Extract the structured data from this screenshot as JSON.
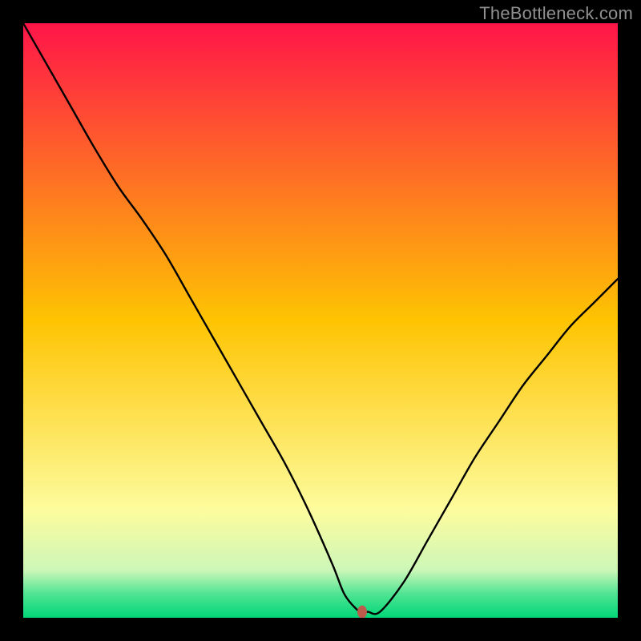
{
  "watermark": "TheBottleneck.com",
  "chart_data": {
    "type": "line",
    "title": "",
    "xlabel": "",
    "ylabel": "",
    "xlim": [
      0,
      100
    ],
    "ylim": [
      0,
      100
    ],
    "grid": false,
    "background_gradient": {
      "stops": [
        {
          "offset": 0,
          "color": "#ff1549"
        },
        {
          "offset": 50,
          "color": "#fec402"
        },
        {
          "offset": 82,
          "color": "#fdfc9e"
        },
        {
          "offset": 92,
          "color": "#ccf7b8"
        },
        {
          "offset": 96,
          "color": "#4fe493"
        },
        {
          "offset": 100,
          "color": "#02d678"
        }
      ]
    },
    "series": [
      {
        "name": "bottleneck-curve",
        "color": "#000000",
        "x": [
          0,
          4,
          8,
          12,
          16,
          20,
          24,
          28,
          32,
          36,
          40,
          44,
          48,
          52,
          54,
          56,
          57,
          58,
          60,
          64,
          68,
          72,
          76,
          80,
          84,
          88,
          92,
          96,
          100
        ],
        "y": [
          100,
          93,
          86,
          79,
          72.5,
          67,
          61,
          54,
          47,
          40,
          33,
          26,
          18,
          9,
          4,
          1.5,
          1,
          1,
          1,
          6,
          13,
          20,
          27,
          33,
          39,
          44,
          49,
          53,
          57
        ]
      }
    ],
    "marker": {
      "name": "optimal-point",
      "x": 57,
      "y": 1,
      "color": "#bc5a4c",
      "rx": 6,
      "ry": 8
    }
  }
}
